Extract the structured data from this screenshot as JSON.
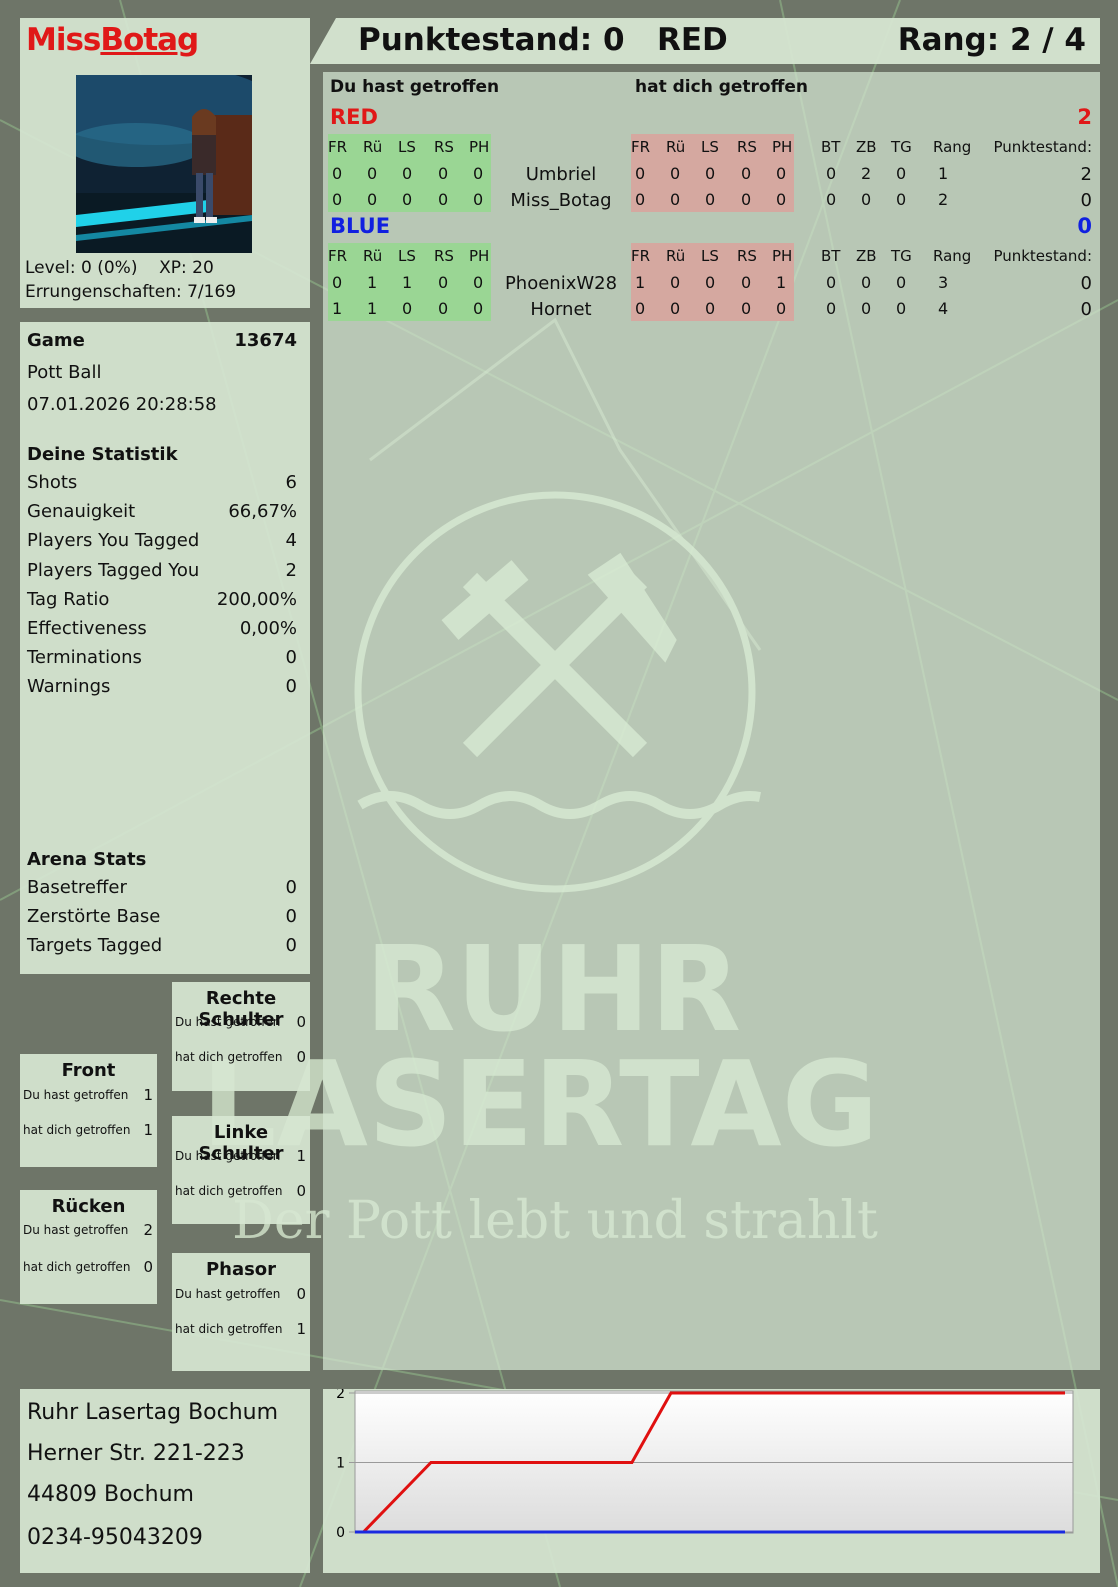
{
  "profile": {
    "name_first": "Miss",
    "name_second": "Botag",
    "level": "Level: 0 (0%)",
    "xp": "XP: 20",
    "achievements": "Errungenschaften: 7/169"
  },
  "header": {
    "score": "Punktestand: 0",
    "team": "RED",
    "rank": "Rang: 2 / 4"
  },
  "board": {
    "you_hit_label": "Du hast getroffen",
    "hit_you_label": "hat dich getroffen",
    "hit_cols": [
      "FR",
      "Rü",
      "LS",
      "RS",
      "PH"
    ],
    "stat_cols": [
      "BT",
      "ZB",
      "TG",
      "Rang"
    ],
    "points_col": "Punktestand:",
    "teams": [
      {
        "name": "RED",
        "color": "#e01818",
        "score": "2",
        "players": [
          {
            "name": "Umbriel",
            "you_hit": [
              "0",
              "0",
              "0",
              "0",
              "0"
            ],
            "hit_you": [
              "0",
              "0",
              "0",
              "0",
              "0"
            ],
            "stats": [
              "0",
              "2",
              "0",
              "1"
            ],
            "points": "2"
          },
          {
            "name": "Miss_Botag",
            "you_hit": [
              "0",
              "0",
              "0",
              "0",
              "0"
            ],
            "hit_you": [
              "0",
              "0",
              "0",
              "0",
              "0"
            ],
            "stats": [
              "0",
              "0",
              "0",
              "2"
            ],
            "points": "0"
          }
        ]
      },
      {
        "name": "BLUE",
        "color": "#1020e0",
        "score": "0",
        "players": [
          {
            "name": "PhoenixW28",
            "you_hit": [
              "0",
              "1",
              "1",
              "0",
              "0"
            ],
            "hit_you": [
              "1",
              "0",
              "0",
              "0",
              "1"
            ],
            "stats": [
              "0",
              "0",
              "0",
              "3"
            ],
            "points": "0"
          },
          {
            "name": "Hornet",
            "you_hit": [
              "1",
              "1",
              "0",
              "0",
              "0"
            ],
            "hit_you": [
              "0",
              "0",
              "0",
              "0",
              "0"
            ],
            "stats": [
              "0",
              "0",
              "0",
              "4"
            ],
            "points": "0"
          }
        ]
      }
    ]
  },
  "game": {
    "label": "Game",
    "id": "13674",
    "mode": "Pott Ball",
    "datetime": "07.01.2026 20:28:58",
    "stats_title": "Deine Statistik",
    "stats": [
      {
        "label": "Shots",
        "value": "6"
      },
      {
        "label": "Genauigkeit",
        "value": "66,67%"
      },
      {
        "label": "Players You Tagged",
        "value": "4"
      },
      {
        "label": "Players Tagged You",
        "value": "2"
      },
      {
        "label": "Tag Ratio",
        "value": "200,00%"
      },
      {
        "label": "Effectiveness",
        "value": "0,00%"
      },
      {
        "label": "Terminations",
        "value": "0"
      },
      {
        "label": "Warnings",
        "value": "0"
      }
    ],
    "arena_title": "Arena Stats",
    "arena": [
      {
        "label": "Basetreffer",
        "value": "0"
      },
      {
        "label": "Zerstörte Base",
        "value": "0"
      },
      {
        "label": "Targets Tagged",
        "value": "0"
      }
    ]
  },
  "hits": {
    "you_hit_label": "Du hast getroffen",
    "hit_you_label": "hat dich getroffen",
    "rechte_schulter": {
      "title": "Rechte Schulter",
      "you_hit": "0",
      "hit_you": "0"
    },
    "front": {
      "title": "Front",
      "you_hit": "1",
      "hit_you": "1"
    },
    "linke_schulter": {
      "title": "Linke Schulter",
      "you_hit": "1",
      "hit_you": "0"
    },
    "ruecken": {
      "title": "Rücken",
      "you_hit": "2",
      "hit_you": "0"
    },
    "phasor": {
      "title": "Phasor",
      "you_hit": "0",
      "hit_you": "1"
    }
  },
  "address": {
    "name": "Ruhr Lasertag Bochum",
    "street": "Herner Str. 221-223",
    "city": "44809 Bochum",
    "phone": "0234-95043209"
  },
  "watermark": {
    "line1": "RUHR",
    "line2": "LASERTAG",
    "slogan": "Der Pott lebt und strahlt"
  },
  "chart_data": {
    "type": "line",
    "title": "",
    "xlabel": "",
    "ylabel": "",
    "ylim": [
      0,
      2
    ],
    "yticks": [
      "0",
      "1",
      "2"
    ],
    "grid": true,
    "series": [
      {
        "color": "#e01010",
        "x": [
          0,
          0.107,
          0.39,
          0.445,
          1
        ],
        "y": [
          0,
          1,
          1,
          2,
          2
        ],
        "start_at_zero_until": 0.107
      },
      {
        "color": "#1a2ae0",
        "x": [
          0,
          1
        ],
        "y": [
          0,
          0
        ]
      }
    ]
  }
}
